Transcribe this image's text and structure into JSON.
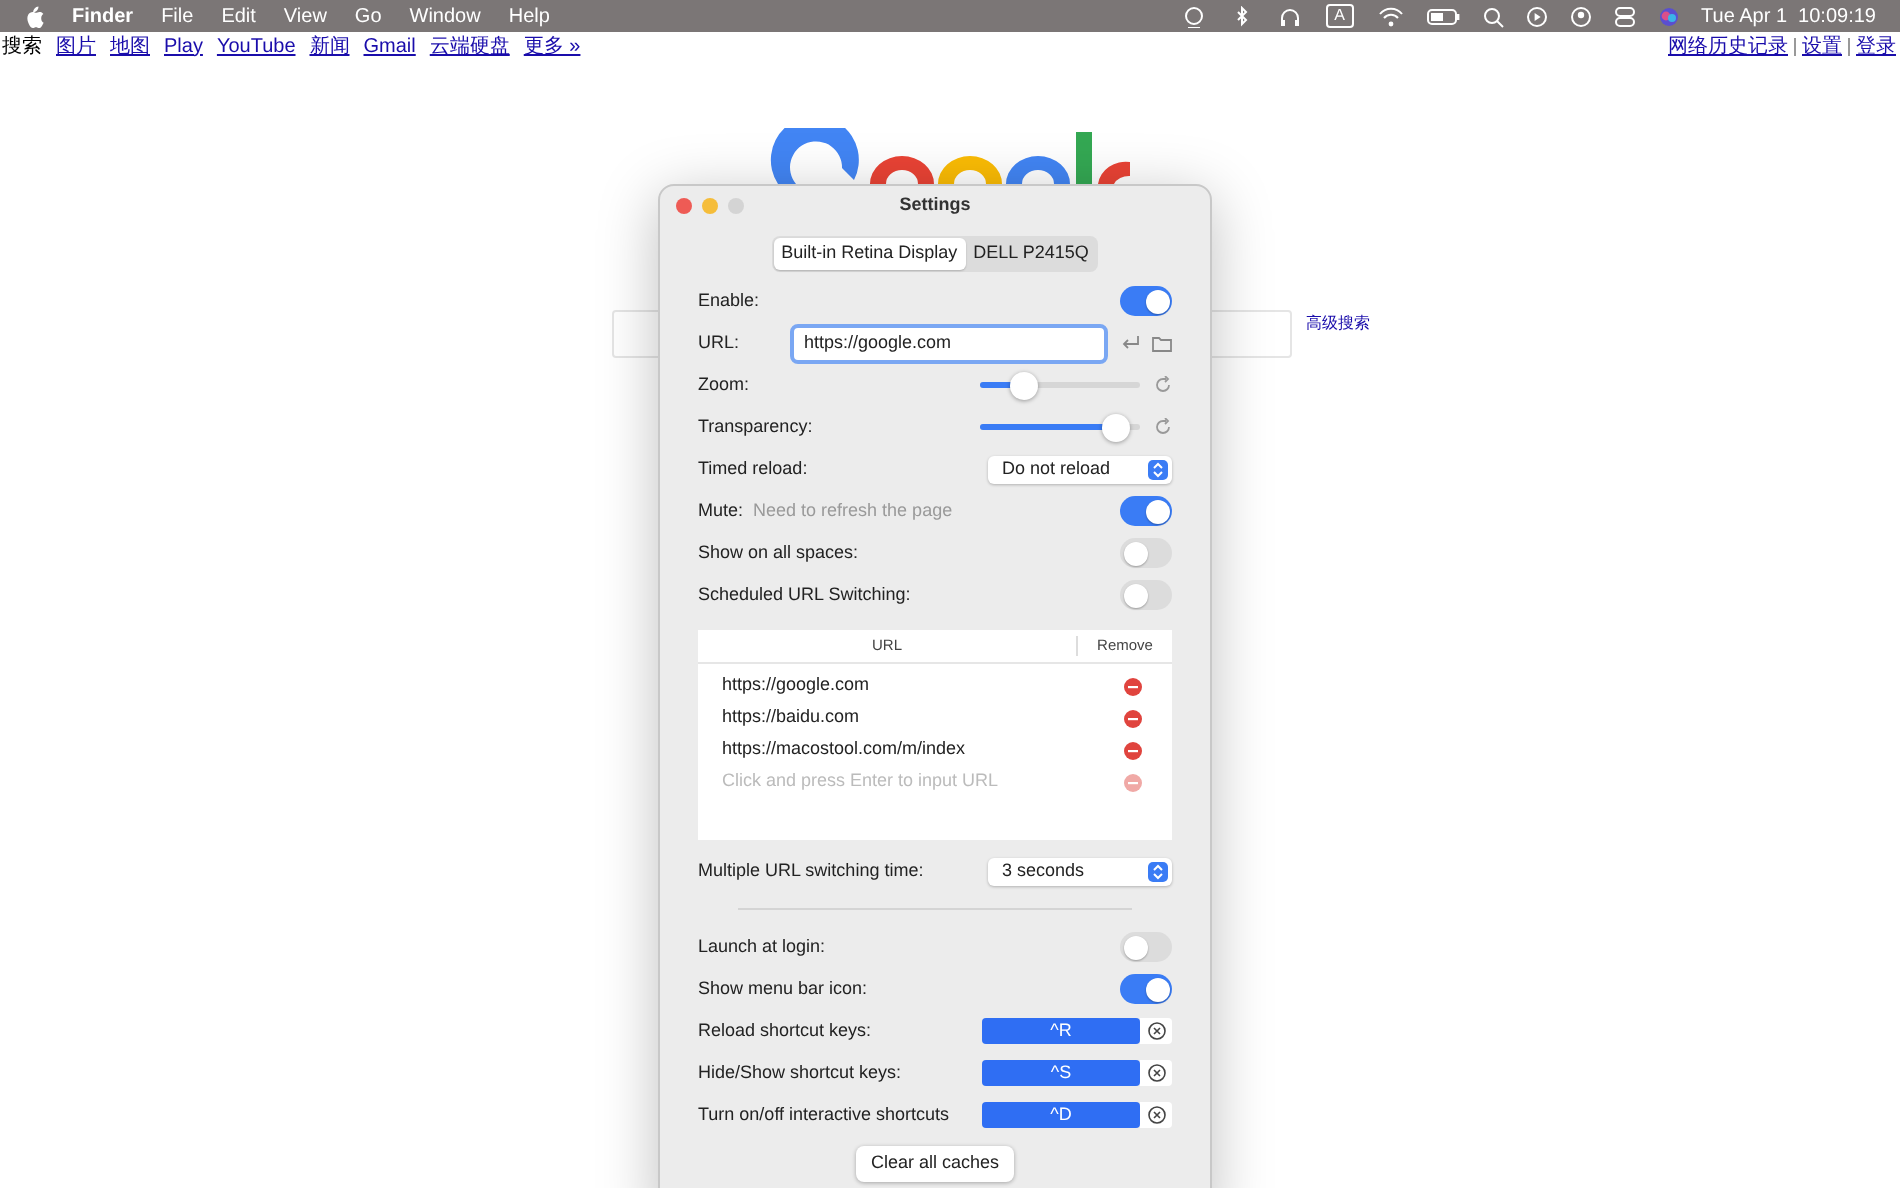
{
  "menu_bar": {
    "app": "Finder",
    "menus": [
      "File",
      "Edit",
      "View",
      "Go",
      "Window",
      "Help"
    ],
    "input_source": "A",
    "clock": "Tue Apr 1  10:09:19"
  },
  "browser": {
    "nav_current": "搜索",
    "nav_links": [
      "图片",
      "地图",
      "Play",
      "YouTube",
      "新闻",
      "Gmail",
      "云端硬盘",
      "更多 »"
    ],
    "account_links": [
      "网络历史记录",
      "设置",
      "登录"
    ],
    "advanced_search": "高级搜索"
  },
  "settings": {
    "title": "Settings",
    "tabs": [
      {
        "label": "Built-in Retina Display",
        "selected": true
      },
      {
        "label": "DELL P2415Q",
        "selected": false
      }
    ],
    "rows": [
      {
        "kind": "toggle",
        "label": "Enable:",
        "on": true
      },
      {
        "kind": "url",
        "label": "URL:",
        "value": "https://google.com"
      },
      {
        "kind": "slider",
        "label": "Zoom:",
        "level": 0.22
      },
      {
        "kind": "slider",
        "label": "Transparency:",
        "level": 0.92
      },
      {
        "kind": "select",
        "label": "Timed reload:",
        "value": "Do not reload"
      },
      {
        "kind": "toggle",
        "label": "Mute:",
        "hint": "Need to refresh the page",
        "on": true
      },
      {
        "kind": "toggle",
        "label": "Show on all spaces:",
        "on": false
      },
      {
        "kind": "toggle",
        "label": "Scheduled URL Switching:",
        "on": false
      }
    ],
    "url_table": {
      "columns": [
        "URL",
        "Remove"
      ],
      "rows": [
        "https://google.com",
        "https://baidu.com",
        "https://macostool.com/m/index"
      ],
      "placeholder": "Click and press Enter to input URL"
    },
    "rows2": [
      {
        "kind": "select",
        "label": "Multiple URL switching time:",
        "value": "3 seconds"
      },
      {
        "kind": "separator"
      },
      {
        "kind": "toggle",
        "label": "Launch at login:",
        "on": false
      },
      {
        "kind": "toggle",
        "label": "Show menu bar icon:",
        "on": true
      },
      {
        "kind": "shortcut",
        "label": "Reload shortcut keys:",
        "value": "^R"
      },
      {
        "kind": "shortcut",
        "label": "Hide/Show shortcut keys:",
        "value": "^S"
      },
      {
        "kind": "shortcut",
        "label": "Turn on/off interactive shortcuts",
        "value": "^D"
      }
    ],
    "clear_button": "Clear all caches"
  }
}
